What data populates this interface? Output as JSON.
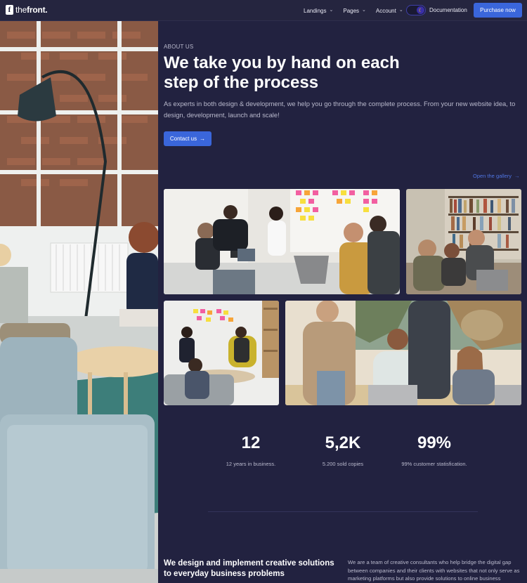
{
  "header": {
    "logo_letter": "f",
    "logo_text_light": "the",
    "logo_text_bold": "front.",
    "nav": [
      {
        "label": "Landings"
      },
      {
        "label": "Pages"
      },
      {
        "label": "Account"
      }
    ],
    "theme_toggle_icon": "moon-icon",
    "documentation_label": "Documentation",
    "purchase_label": "Purchase now"
  },
  "hero": {
    "eyebrow": "ABOUT US",
    "headline": "We take you by hand on each step of the process",
    "lead": "As experts in both design & development, we help you go through the complete process. From your new website idea, to design, development, launch and scale!",
    "contact_label": "Contact us",
    "contact_icon": "arrow-right-icon",
    "gallery_label": "Open the gallery",
    "gallery_icon": "arrow-right-icon"
  },
  "stats": [
    {
      "value": "12",
      "label": "12 years in business."
    },
    {
      "value": "5,2K",
      "label": "5.200 sold copies"
    },
    {
      "value": "99%",
      "label": "99% customer statisfication."
    }
  ],
  "section": {
    "heading": "We design and implement creative solutions to everyday business problems",
    "text": "We are a team of creative consultants who help bridge the digital gap between companies and their clients with websites that not only serve as marketing platforms but also provide solutions to online business"
  },
  "colors": {
    "background": "#222240",
    "header": "#25253f",
    "accent": "#3a66db",
    "link": "#4f74e0"
  }
}
